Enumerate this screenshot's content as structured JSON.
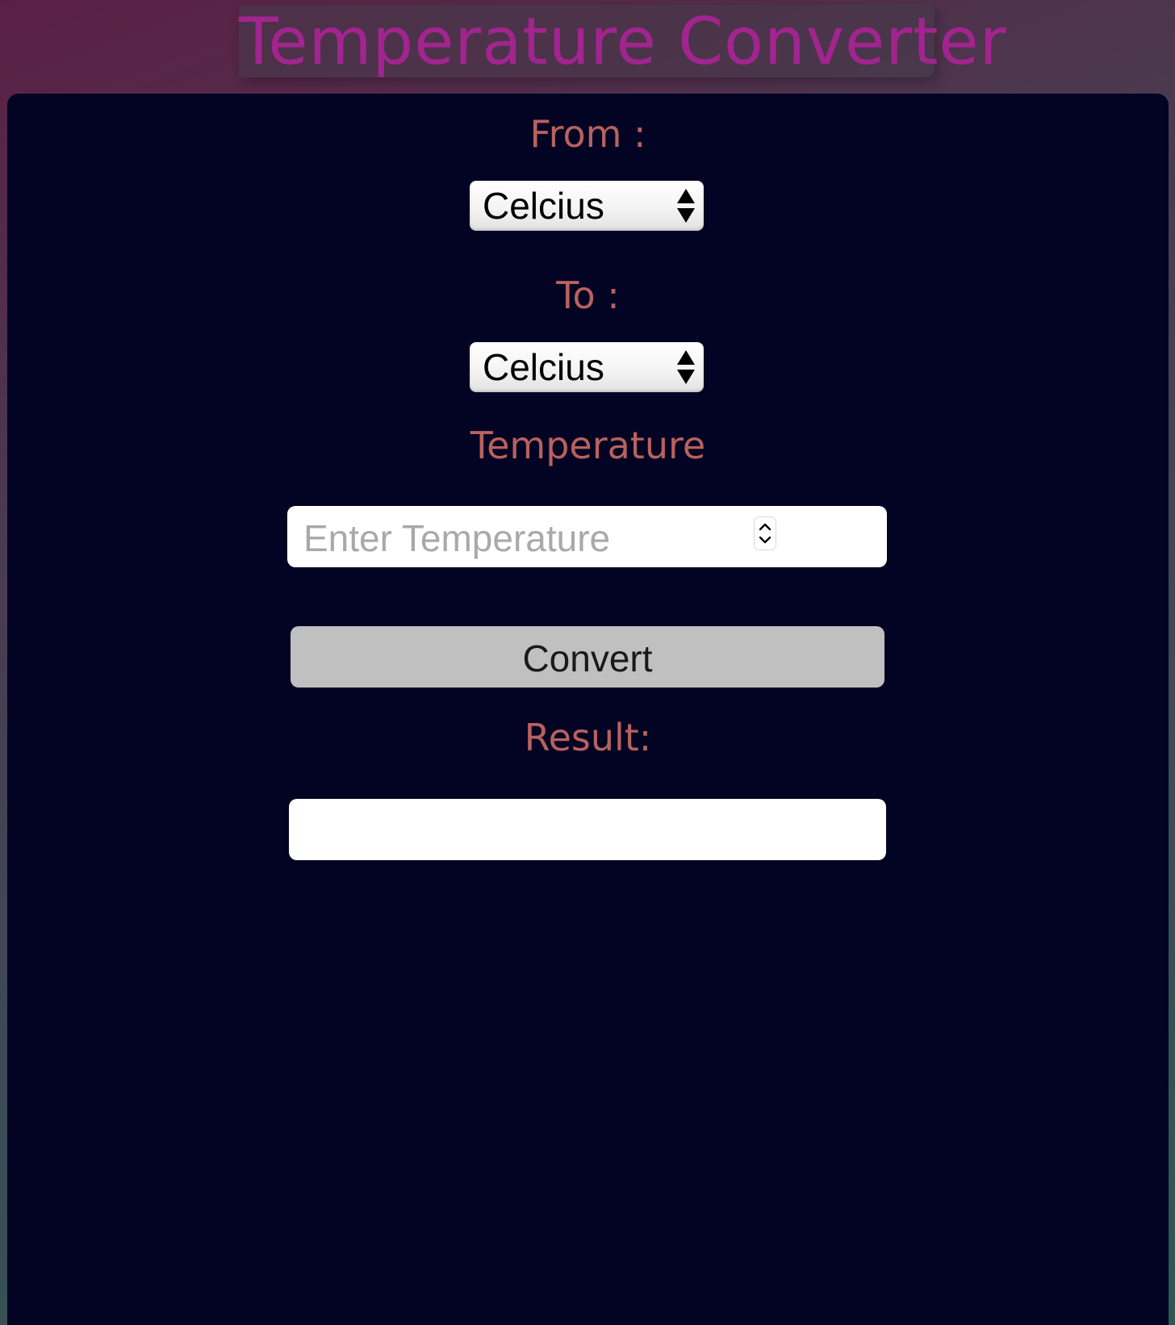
{
  "app": {
    "title": "Temperature Converter"
  },
  "colors": {
    "title": "#a2248f",
    "label": "#b8615e",
    "panel": "#030423",
    "button": "#c0c0c0"
  },
  "form": {
    "from_label": "From :",
    "from_value": "Celcius",
    "to_label": "To :",
    "to_value": "Celcius",
    "temperature_label": "Temperature",
    "temperature_placeholder": "Enter Temperature",
    "temperature_value": "",
    "convert_label": "Convert",
    "result_label": "Result:",
    "result_value": ""
  },
  "icons": {
    "select_arrows": "updown-arrows-icon",
    "number_spinner": "spinner-chevrons-icon"
  }
}
